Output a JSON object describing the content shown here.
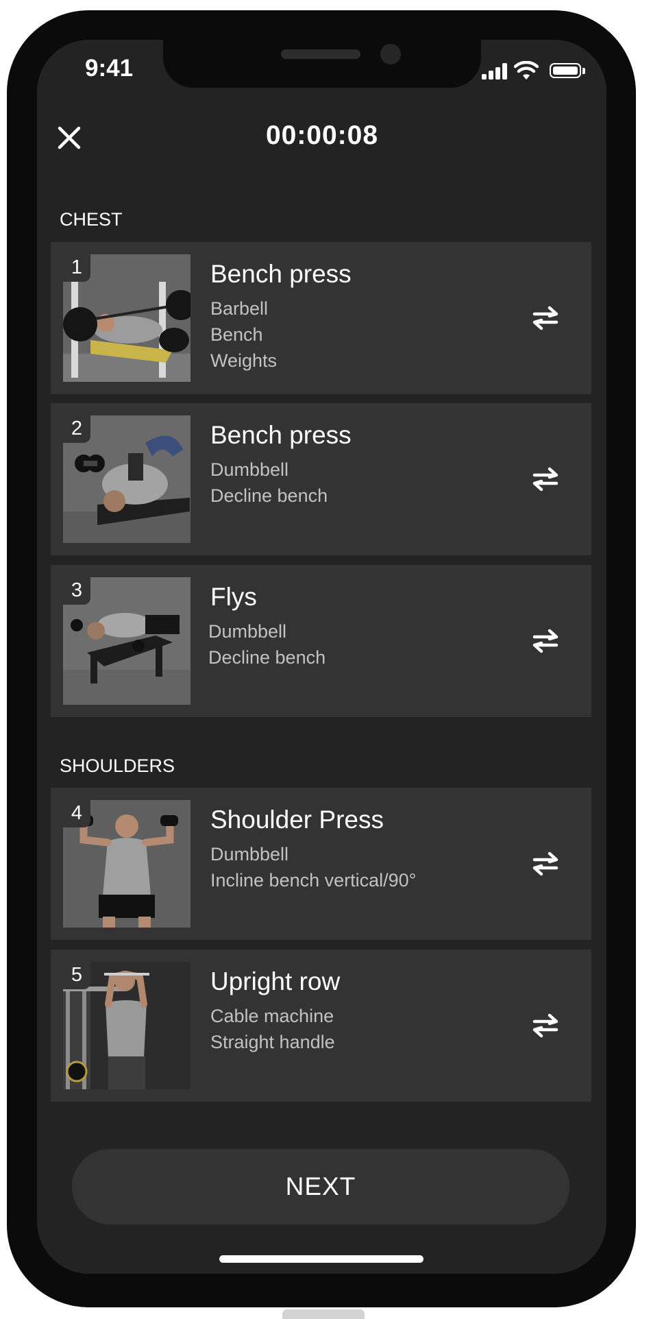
{
  "status_bar": {
    "time": "9:41",
    "icons": [
      "signal-icon",
      "wifi-icon",
      "battery-icon"
    ]
  },
  "header": {
    "timer": "00:00:08",
    "close_icon": "close-icon"
  },
  "sections": [
    {
      "title": "CHEST",
      "exercises": [
        {
          "number": "1",
          "name": "Bench press",
          "tags": [
            "Barbell",
            "Bench",
            "Weights"
          ]
        },
        {
          "number": "2",
          "name": "Bench press",
          "tags": [
            "Dumbbell",
            "Decline bench"
          ]
        },
        {
          "number": "3",
          "name": "Flys",
          "tags": [
            "Dumbbell",
            "Decline bench"
          ]
        }
      ]
    },
    {
      "title": "SHOULDERS",
      "exercises": [
        {
          "number": "4",
          "name": "Shoulder Press",
          "tags": [
            "Dumbbell",
            "Incline bench vertical/90°"
          ]
        },
        {
          "number": "5",
          "name": "Upright row",
          "tags": [
            "Cable machine",
            "Straight handle"
          ]
        }
      ]
    }
  ],
  "next_button": {
    "label": "NEXT"
  },
  "colors": {
    "background": "#232323",
    "card": "#333333",
    "text": "#ffffff",
    "secondary_text": "#c2c2c2"
  }
}
